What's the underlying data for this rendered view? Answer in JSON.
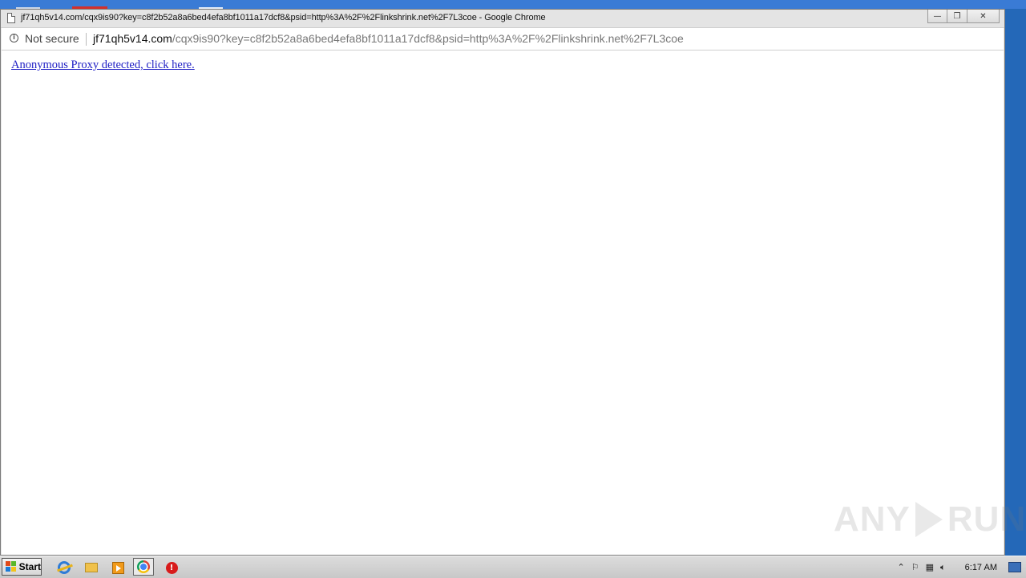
{
  "window": {
    "title": "jf71qh5v14.com/cqx9is90?key=c8f2b52a8a6bed4efa8bf1011a17dcf8&psid=http%3A%2F%2Flinkshrink.net%2F7L3coe - Google Chrome",
    "controls": {
      "minimize": "—",
      "maximize": "❐",
      "close": "✕"
    }
  },
  "addressbar": {
    "security_label": "Not secure",
    "url_host": "jf71qh5v14.com",
    "url_path": "/cqx9is90?key=c8f2b52a8a6bed4efa8bf1011a17dcf8&psid=http%3A%2F%2Flinkshrink.net%2F7L3coe"
  },
  "page": {
    "link_text": "Anonymous Proxy detected, click here."
  },
  "watermark": {
    "left": "ANY",
    "right": "RUN"
  },
  "taskbar": {
    "start_label": "Start",
    "icons": [
      "internet-explorer-icon",
      "folder-icon",
      "media-player-icon",
      "chrome-icon",
      "stop-icon"
    ],
    "tray": {
      "clock": "6:17 AM"
    }
  }
}
